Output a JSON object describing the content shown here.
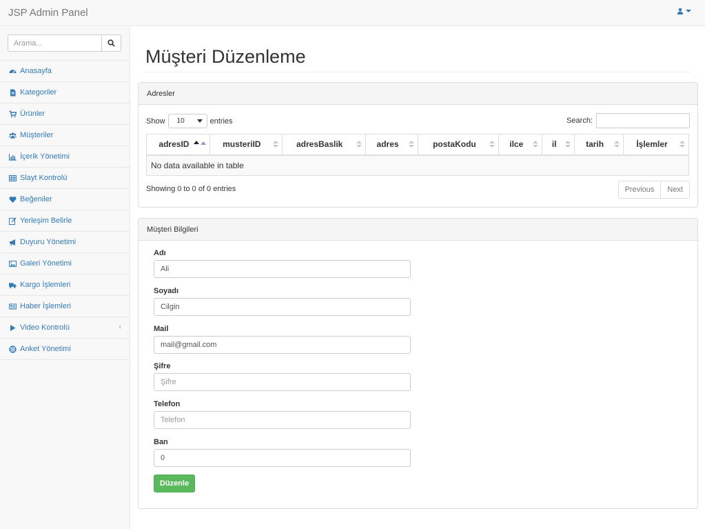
{
  "app": {
    "brand": "JSP Admin Panel"
  },
  "sidebar": {
    "search_placeholder": "Arama...",
    "items": [
      {
        "label": "Anasayfa",
        "icon": "dashboard-icon"
      },
      {
        "label": "Kategoriler",
        "icon": "file-icon"
      },
      {
        "label": "Ürünler",
        "icon": "cart-icon"
      },
      {
        "label": "Müşteriler",
        "icon": "users-icon"
      },
      {
        "label": "İçerik Yönetimi",
        "icon": "bar-chart-icon"
      },
      {
        "label": "Slayt Kontrolü",
        "icon": "table-icon"
      },
      {
        "label": "Beğeniler",
        "icon": "heart-icon"
      },
      {
        "label": "Yerleşim Belirle",
        "icon": "edit-icon"
      },
      {
        "label": "Duyuru Yönetimi",
        "icon": "bullhorn-icon"
      },
      {
        "label": "Galeri Yönetimi",
        "icon": "image-icon"
      },
      {
        "label": "Kargo İşlemleri",
        "icon": "truck-icon"
      },
      {
        "label": "Haber İşlemleri",
        "icon": "newspaper-icon"
      },
      {
        "label": "Video Kontrolü",
        "icon": "play-icon",
        "arrow": "‹"
      },
      {
        "label": "Anket Yönetimi",
        "icon": "life-ring-icon"
      }
    ]
  },
  "page": {
    "title": "Müşteri Düzenleme"
  },
  "addresses": {
    "heading": "Adresler",
    "show_label": "Show",
    "page_length": "10",
    "entries_label": "entries",
    "search_label": "Search:",
    "columns": [
      "adresID",
      "musteriID",
      "adresBaslik",
      "adres",
      "postaKodu",
      "ilce",
      "il",
      "tarih",
      "İşlemler"
    ],
    "empty_message": "No data available in table",
    "info": "Showing 0 to 0 of 0 entries",
    "prev_label": "Previous",
    "next_label": "Next"
  },
  "customer": {
    "heading": "Müşteri Bilgileri",
    "fields": [
      {
        "label": "Adı",
        "value": "Ali",
        "placeholder": ""
      },
      {
        "label": "Soyadı",
        "value": "Cilgin",
        "placeholder": ""
      },
      {
        "label": "Mail",
        "value": "mail@gmail.com",
        "placeholder": ""
      },
      {
        "label": "Şifre",
        "value": "",
        "placeholder": "Şifre"
      },
      {
        "label": "Telefon",
        "value": "",
        "placeholder": "Telefon"
      },
      {
        "label": "Ban",
        "value": "0",
        "placeholder": ""
      }
    ],
    "submit_label": "Düzenle"
  },
  "colors": {
    "link": "#337ab7",
    "success": "#5cb85c",
    "navbar_bg": "#f8f8f8"
  }
}
